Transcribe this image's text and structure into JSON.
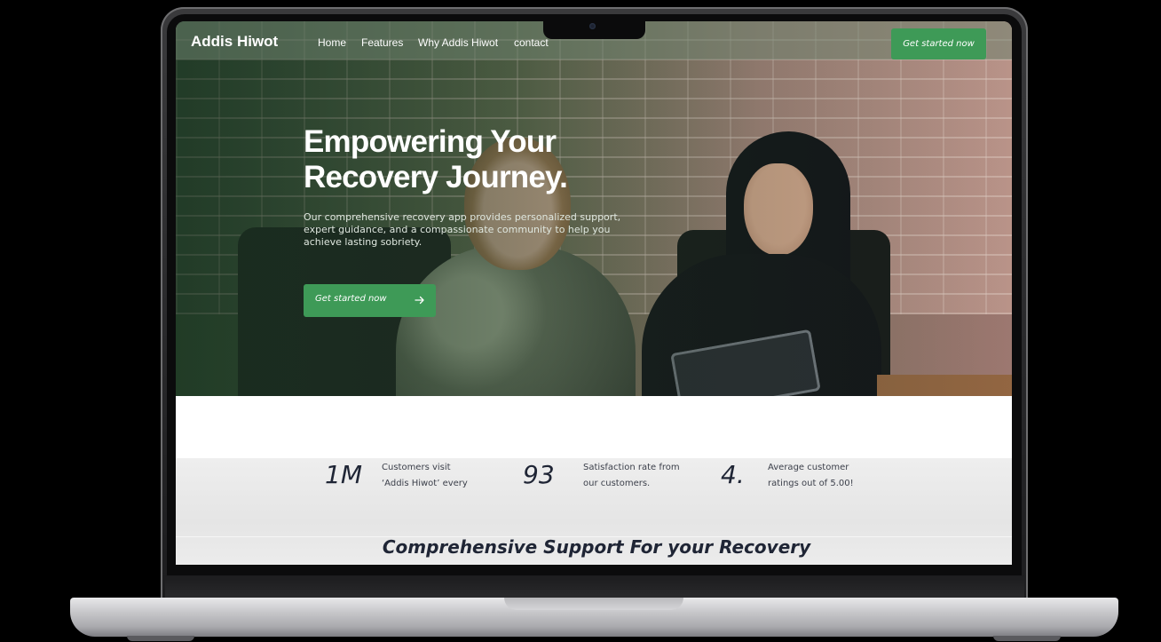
{
  "nav": {
    "brand": "Addis Hiwot",
    "links": [
      "Home",
      "Features",
      "Why Addis Hiwot",
      "contact"
    ],
    "cta_label": "Get started now"
  },
  "hero": {
    "title_line1": "Empowering Your",
    "title_line2": "Recovery Journey.",
    "description": "Our comprehensive recovery app provides personalized support, expert guidance, and a compassionate community to help you achieve lasting sobriety.",
    "cta_label": "Get started now",
    "cta_icon": "arrow-right-icon"
  },
  "stats": [
    {
      "value": "1M",
      "text": "Customers visit ‘Addis Hiwot’ every"
    },
    {
      "value": "93",
      "text": "Satisfaction rate from our customers."
    },
    {
      "value": "4.",
      "text": "Average customer ratings out of 5.00!"
    }
  ],
  "section": {
    "heading": "Comprehensive Support For your Recovery"
  },
  "colors": {
    "accent_green": "#3e9a57",
    "heading_dark": "#1f2535",
    "stats_bg": "#eeeeee"
  }
}
